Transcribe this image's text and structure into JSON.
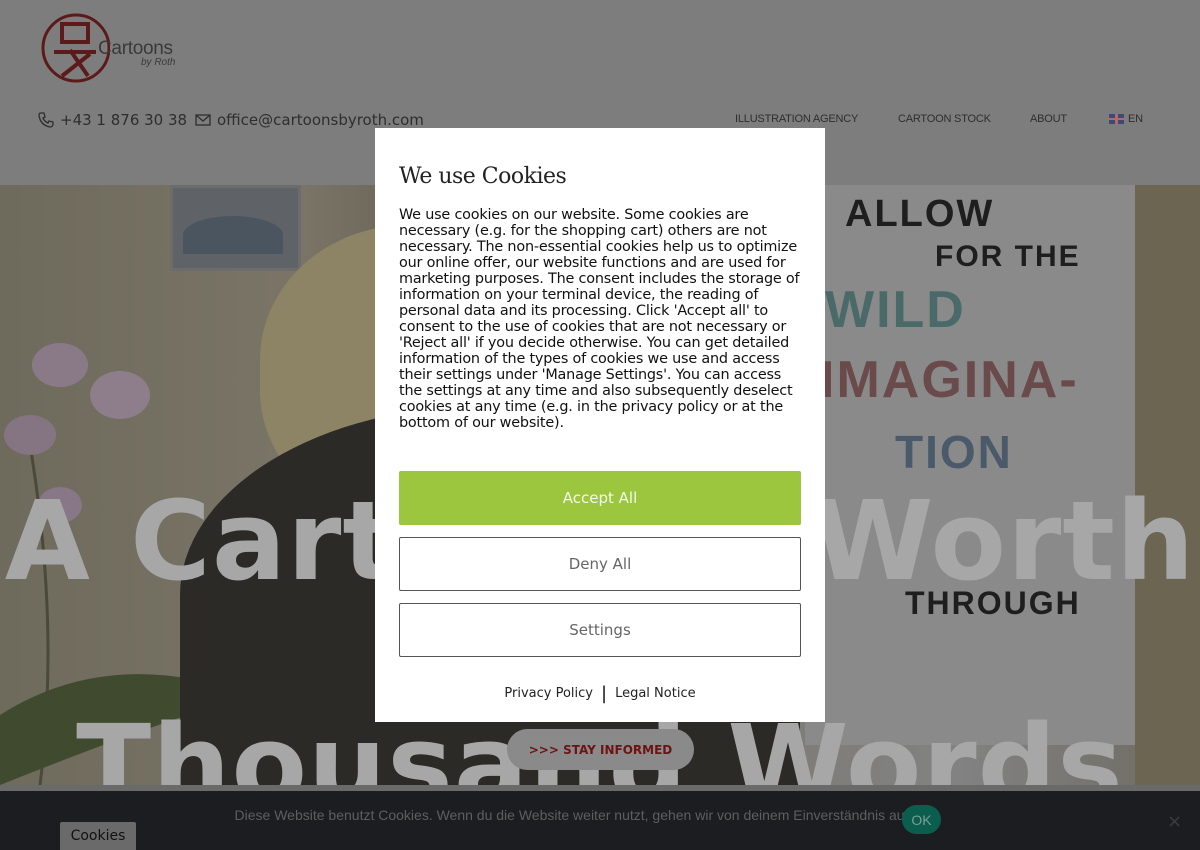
{
  "header": {
    "logo_text": "Cartoons",
    "logo_subtext": "by Roth",
    "phone": "+43 1 876 30 38",
    "email": "office@cartoonsbyroth.com",
    "nav": [
      {
        "label": "ILLUSTRATION AGENCY"
      },
      {
        "label": "CARTOON STOCK"
      },
      {
        "label": "ABOUT"
      },
      {
        "label": "EN"
      }
    ]
  },
  "hero": {
    "title_line1": "A Cartoon is Worth a",
    "title_line2": "Thousand Words",
    "cta_label": ">>> STAY INFORMED",
    "board_text": [
      "ALLOW",
      "FOR THE",
      "WILD",
      "IMAGINA-",
      "TION",
      "THROUGH"
    ]
  },
  "modal": {
    "title": "We use Cookies",
    "body": "We use cookies on our website. Some cookies are necessary (e.g. for the shopping cart) others are not necessary. The non-essential cookies help us to optimize our online offer, our website functions and are used for marketing purposes. The consent includes the storage of information on your terminal device, the reading of personal data and its processing. Click 'Accept all' to consent to the use of cookies that are not necessary or 'Reject all' if you decide otherwise. You can get detailed information of the types of cookies we use and access their settings under 'Manage Settings'. You can access the settings at any time and also subsequently deselect cookies at any time (e.g. in the privacy policy or at the bottom of our website).",
    "accept_label": "Accept All",
    "deny_label": "Deny All",
    "settings_label": "Settings",
    "privacy_link": "Privacy Policy",
    "separator": "|",
    "legal_link": "Legal Notice"
  },
  "cookie_bar": {
    "text": "Diese Website benutzt Cookies. Wenn du die Website weiter nutzt, gehen wir von deinem Einverständnis aus.",
    "ok_label": "OK",
    "close_label": "×"
  },
  "cookies_tab": {
    "label": "Cookies"
  },
  "colors": {
    "accent_green": "#9cc63d",
    "cta_text": "#6e1212",
    "ok_button": "#0b5e4e"
  }
}
